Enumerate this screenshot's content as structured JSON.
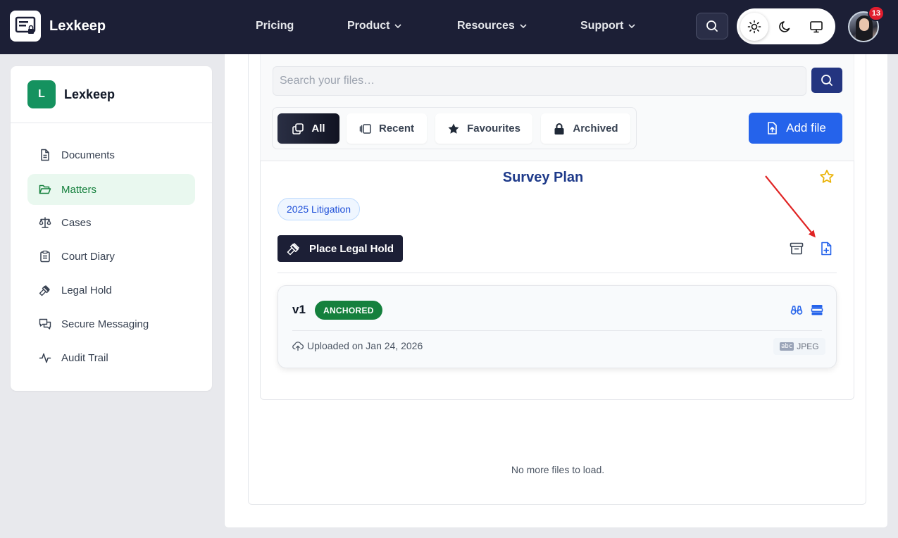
{
  "topbar": {
    "brand": "Lexkeep",
    "nav": [
      {
        "label": "Pricing",
        "has_dropdown": false
      },
      {
        "label": "Product",
        "has_dropdown": true
      },
      {
        "label": "Resources",
        "has_dropdown": true
      },
      {
        "label": "Support",
        "has_dropdown": true
      }
    ],
    "theme_options": [
      "sun-icon",
      "moon-icon",
      "monitor-icon"
    ],
    "theme_selected": "sun-icon",
    "notifications_count": "13"
  },
  "sidebar": {
    "logo_letter": "L",
    "title": "Lexkeep",
    "items": [
      {
        "label": "Documents",
        "icon": "document-icon",
        "active": false
      },
      {
        "label": "Matters",
        "icon": "folder-open-icon",
        "active": true
      },
      {
        "label": "Cases",
        "icon": "scales-icon",
        "active": false
      },
      {
        "label": "Court Diary",
        "icon": "clipboard-icon",
        "active": false
      },
      {
        "label": "Legal Hold",
        "icon": "gavel-icon",
        "active": false
      },
      {
        "label": "Secure Messaging",
        "icon": "chat-icon",
        "active": false
      },
      {
        "label": "Audit Trail",
        "icon": "activity-icon",
        "active": false
      }
    ]
  },
  "search": {
    "placeholder": "Search your files…",
    "value": ""
  },
  "filters": [
    {
      "label": "All",
      "icon": "copy-icon",
      "active": true
    },
    {
      "label": "Recent",
      "icon": "gallery-icon",
      "active": false
    },
    {
      "label": "Favourites",
      "icon": "star-icon",
      "active": false
    },
    {
      "label": "Archived",
      "icon": "lock-icon",
      "active": false
    }
  ],
  "add_file_label": "Add file",
  "file": {
    "title": "Survey Plan",
    "tag": "2025 Litigation",
    "hold_button": "Place Legal Hold",
    "version": {
      "label": "v1",
      "status": "ANCHORED",
      "uploaded": "Uploaded on Jan 24, 2026",
      "file_type": "JPEG"
    }
  },
  "footer_note": "No more files to load.",
  "colors": {
    "nav_bg": "#1c1f36",
    "accent_blue": "#2563eb",
    "active_green": "#15803d",
    "title_navy": "#1e3a8a",
    "star_gold": "#eab308",
    "annotation_red": "#e02424"
  }
}
